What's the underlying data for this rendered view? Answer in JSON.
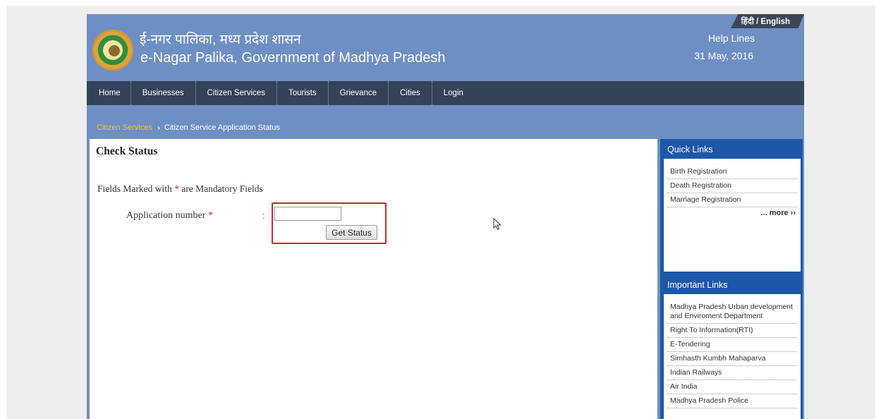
{
  "header": {
    "language_toggle": "हिंदी / English",
    "title_hindi": "ई-नगर पालिका, मध्य प्रदेश शासन",
    "title_english": "e-Nagar Palika, Government of Madhya Pradesh",
    "help_lines": "Help Lines",
    "date": "31 May, 2016"
  },
  "nav": {
    "items": [
      "Home",
      "Businesses",
      "Citizen Services",
      "Tourists",
      "Grievance",
      "Cities",
      "Login"
    ]
  },
  "breadcrumb": {
    "parent": "Citizen Services",
    "separator": "›",
    "current": "Citizen Service Application Status"
  },
  "main": {
    "heading": "Check Status",
    "mandatory_note_prefix": "Fields Marked with",
    "mandatory_star": "*",
    "mandatory_note_suffix": "are Mandatory Fields",
    "application_label": "Application number",
    "required_star": "*",
    "colon": ":",
    "application_value": "",
    "status_button": "Get Status"
  },
  "sidebar": {
    "quick_links": {
      "title": "Quick Links",
      "items": [
        "Birth Registration",
        "Death Registration",
        "Marriage Registration"
      ],
      "more": "... more ››"
    },
    "important_links": {
      "title": "Important Links",
      "items": [
        "Madhya Pradesh Urban development and Enviroment Department",
        "Right To Information(RTI)",
        "E-Tendering",
        "Simhasth Kumbh Mahaparva",
        "Indian Railways",
        "Air India",
        "Madhya Pradesh Police"
      ]
    }
  },
  "colors": {
    "header_blue": "#6e8fc3",
    "nav_dark": "#34425a",
    "sidebar_blue": "#1d57a8",
    "highlight_red": "#d0262c",
    "breadcrumb_link": "#f0c050"
  }
}
